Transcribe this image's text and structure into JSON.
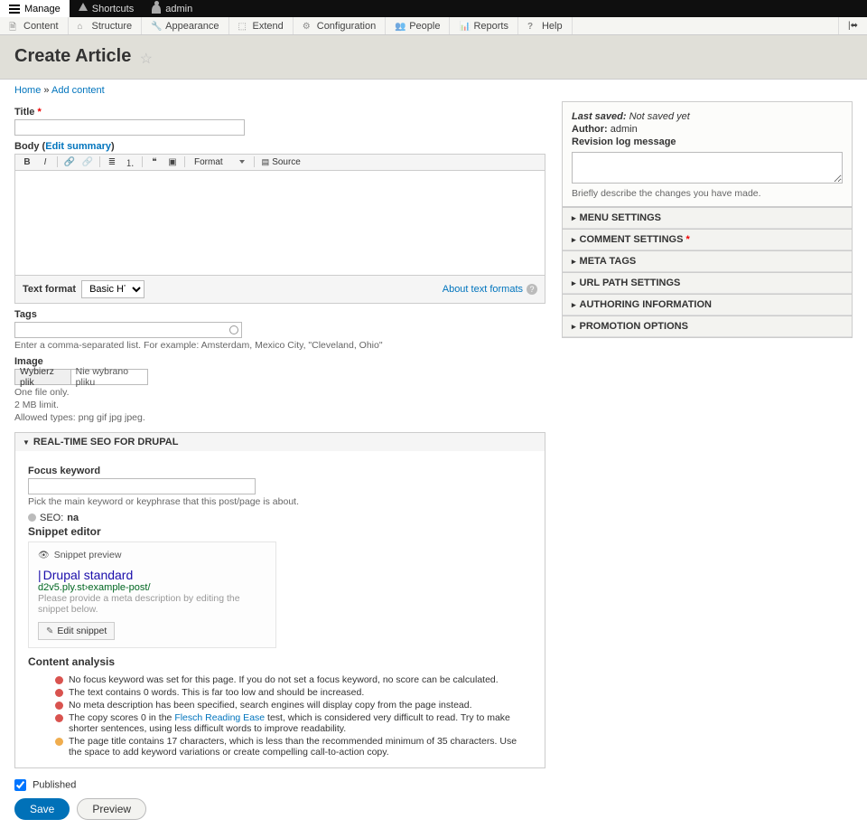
{
  "toolbar": {
    "manage": "Manage",
    "shortcuts": "Shortcuts",
    "user": "admin"
  },
  "admin_menu": {
    "items": [
      {
        "label": "Content"
      },
      {
        "label": "Structure"
      },
      {
        "label": "Appearance"
      },
      {
        "label": "Extend"
      },
      {
        "label": "Configuration"
      },
      {
        "label": "People"
      },
      {
        "label": "Reports"
      },
      {
        "label": "Help"
      }
    ]
  },
  "page_title": "Create Article",
  "breadcrumb": {
    "home": "Home",
    "sep": "»",
    "current": "Add content"
  },
  "form": {
    "title_label": "Title",
    "body_label": "Body",
    "edit_summary": "Edit summary",
    "toolbar": {
      "format": "Format",
      "source": "Source"
    },
    "textformat_label": "Text format",
    "textformat_value": "Basic HTML",
    "about_text_formats": "About text formats",
    "tags_label": "Tags",
    "tags_help": "Enter a comma-separated list. For example: Amsterdam, Mexico City, \"Cleveland, Ohio\"",
    "image_label": "Image",
    "file_button": "Wybierz plik",
    "file_status": "Nie wybrano pliku",
    "file_help1": "One file only.",
    "file_help2": "2 MB limit.",
    "file_help3": "Allowed types: png gif jpg jpeg."
  },
  "seo": {
    "heading": "REAL-TIME SEO FOR DRUPAL",
    "focuskw_label": "Focus keyword",
    "focuskw_help": "Pick the main keyword or keyphrase that this post/page is about.",
    "status_text": "SEO: ",
    "status_value": "na",
    "snippet_editor": "Snippet editor",
    "snippet_preview": "Snippet preview",
    "snippet_title": "Drupal standard",
    "snippet_url": "d2v5.ply.st›example-post/",
    "snippet_desc": "Please provide a meta description by editing the snippet below.",
    "edit_snippet": "Edit snippet",
    "content_analysis": "Content analysis",
    "analysis": [
      {
        "color": "red",
        "text": "No focus keyword was set for this page. If you do not set a focus keyword, no score can be calculated."
      },
      {
        "color": "red",
        "text": "The text contains 0 words. This is far too low and should be increased."
      },
      {
        "color": "red",
        "text": "No meta description has been specified, search engines will display copy from the page instead."
      },
      {
        "color": "red",
        "text_pre": "The copy scores 0 in the ",
        "link": "Flesch Reading Ease",
        "text_post": " test, which is considered very difficult to read. Try to make shorter sentences, using less difficult words to improve readability."
      },
      {
        "color": "orange",
        "text": "The page title contains 17 characters, which is less than the recommended minimum of 35 characters. Use the space to add keyword variations or create compelling call-to-action copy."
      }
    ]
  },
  "sidebar": {
    "last_saved_label": "Last saved:",
    "last_saved_value": "Not saved yet",
    "author_label": "Author:",
    "author_value": "admin",
    "revision_label": "Revision log message",
    "revision_help": "Briefly describe the changes you have made.",
    "sections": [
      {
        "label": "MENU SETTINGS"
      },
      {
        "label": "COMMENT SETTINGS",
        "required": true
      },
      {
        "label": "META TAGS"
      },
      {
        "label": "URL PATH SETTINGS"
      },
      {
        "label": "AUTHORING INFORMATION"
      },
      {
        "label": "PROMOTION OPTIONS"
      }
    ]
  },
  "footer": {
    "published": "Published",
    "save": "Save",
    "preview": "Preview"
  }
}
